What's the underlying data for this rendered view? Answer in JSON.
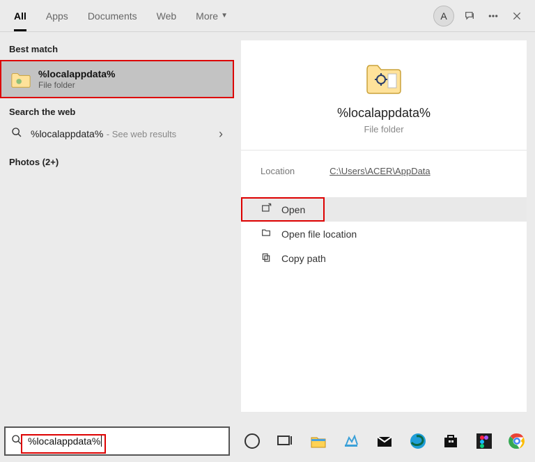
{
  "header": {
    "tabs": [
      "All",
      "Apps",
      "Documents",
      "Web",
      "More"
    ],
    "avatar_initial": "A"
  },
  "left": {
    "best_match_label": "Best match",
    "item_title": "%localappdata%",
    "item_sub": "File folder",
    "search_web_label": "Search the web",
    "web_query": "%localappdata%",
    "web_hint": "- See web results",
    "photos_label": "Photos (2+)"
  },
  "preview": {
    "title": "%localappdata%",
    "subtitle": "File folder",
    "location_key": "Location",
    "location_value": "C:\\Users\\ACER\\AppData",
    "actions": {
      "open": "Open",
      "open_file_location": "Open file location",
      "copy_path": "Copy path"
    }
  },
  "search": {
    "value": "%localappdata%"
  }
}
